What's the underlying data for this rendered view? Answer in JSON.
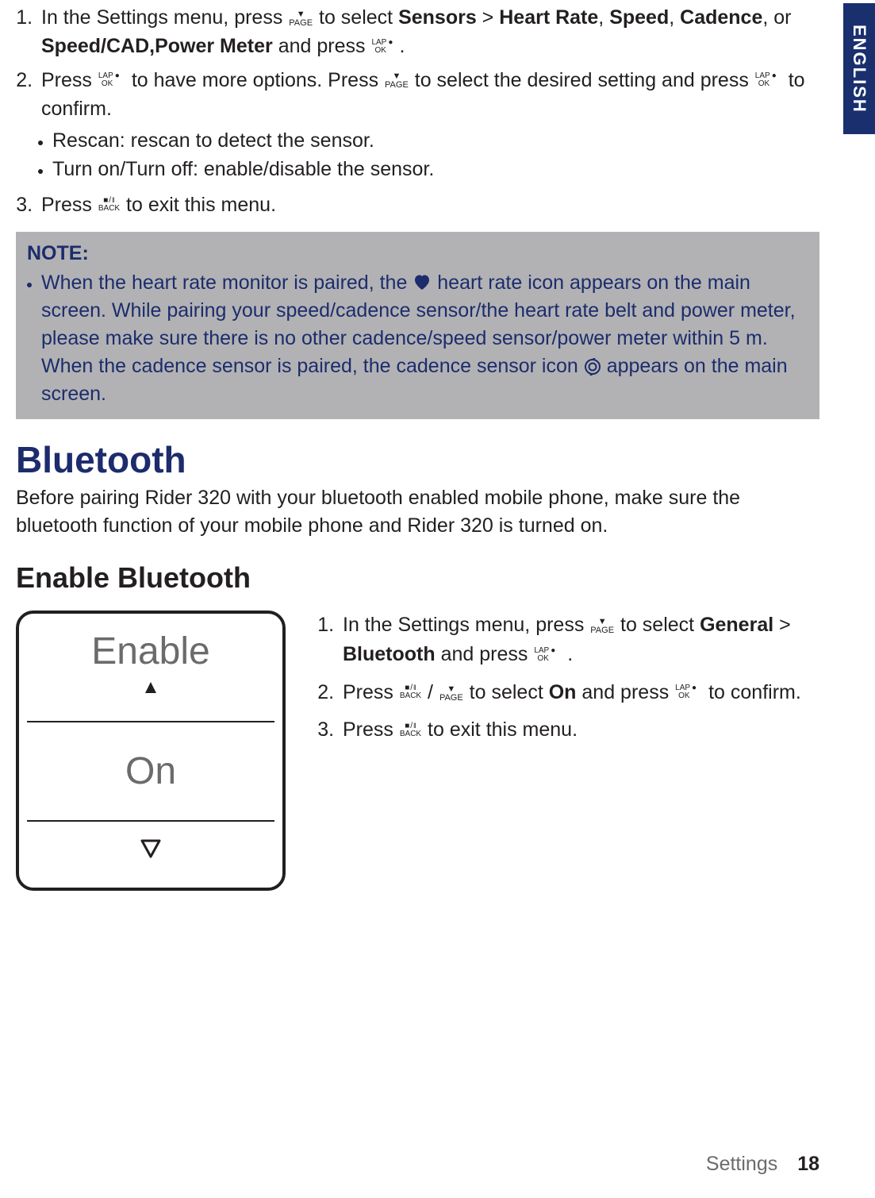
{
  "lang_tab": "ENGLISH",
  "top": {
    "step1": {
      "pre": "In the Settings menu, press ",
      "mid1": " to select ",
      "b1": "Sensors",
      "gt": " > ",
      "b2": "Heart Rate",
      "c1": ", ",
      "b3": "Speed",
      "c2": ", ",
      "b4": "Cadence",
      "or": ", or ",
      "b5": "Speed/CAD,Power Meter",
      "post": " and press ",
      "dot": "."
    },
    "step2": {
      "pre": "Press ",
      "mid1": "to have more options. Press ",
      "mid2": " to select the desired setting and press ",
      "post": " to confirm.",
      "sub1": "Rescan: rescan to detect the sensor.",
      "sub2": "Turn on/Turn off: enable/disable the sensor."
    },
    "step3": {
      "pre": "Press ",
      "post": " to exit this menu."
    }
  },
  "note": {
    "hdr": "NOTE:",
    "body_pre": "When the heart rate monitor is paired, the ",
    "body_mid": " heart rate icon appears on the main screen. While pairing your speed/cadence sensor/the heart rate belt and power meter, please make sure there is no other cadence/speed sensor/power meter within 5 m. When the cadence sensor is paired, the cadence sensor icon",
    "body_post": "appears on the main screen."
  },
  "bt_heading": "Bluetooth",
  "bt_intro": "Before pairing Rider 320 with your bluetooth enabled mobile phone, make sure the bluetooth function of your mobile phone and Rider 320 is turned on.",
  "enable_heading": "Enable Bluetooth",
  "device": {
    "r1": "Enable",
    "r2": "On"
  },
  "steps_right": {
    "s1": {
      "pre": "In the Settings menu, press ",
      "mid": " to select ",
      "b1": "General",
      "gt": " > ",
      "b2": "Bluetooth",
      "post": " and press ",
      "dot": " ."
    },
    "s2": {
      "pre": "Press ",
      "slash": "/",
      "mid": " to select ",
      "b1": "On",
      "post1": " and press ",
      "post2": " to confirm."
    },
    "s3": {
      "pre": "Press ",
      "post": " to exit this menu."
    }
  },
  "footer_label": "Settings",
  "footer_page": "18",
  "icons": {
    "page_lbl": "PAGE",
    "lap": "LAP",
    "ok": "OK",
    "back": "BACK"
  }
}
